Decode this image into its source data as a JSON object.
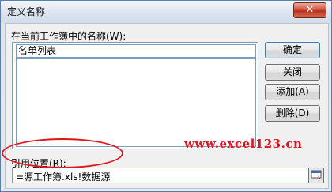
{
  "window": {
    "title": "定义名称",
    "close_label": "✕"
  },
  "names_section": {
    "label": "在当前工作簿中的名称(W):",
    "name_value": "名单列表",
    "list_items": []
  },
  "buttons": {
    "ok": "确定",
    "close": "关闭",
    "add": "添加(A)",
    "delete": "删除(D)"
  },
  "refers_to": {
    "label": "引用位置(R):",
    "value": "=源工作簿.xls!数据源"
  },
  "watermark": {
    "text": "www.excel123.cn"
  },
  "colors": {
    "annotation_red": "#e0141e",
    "accent_border": "#3c7fb1"
  },
  "icons": {
    "collapse": "collapse-dialog-icon"
  }
}
